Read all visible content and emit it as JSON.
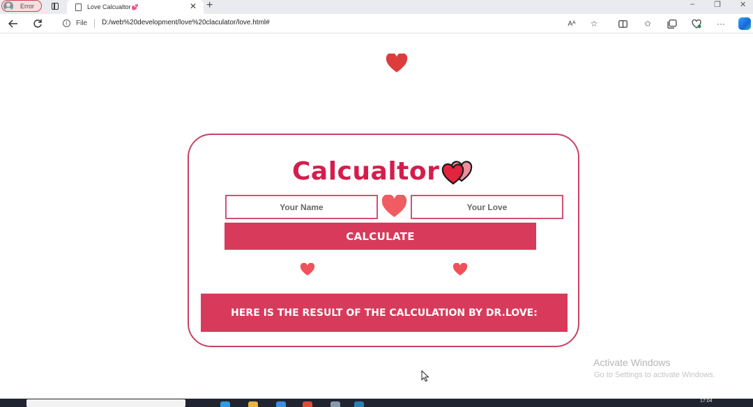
{
  "browser": {
    "profile_label": "Error",
    "tab_title": "Love Calcualtor",
    "tab_heart": "💕",
    "new_tab": "+",
    "tab_close": "✕",
    "file_label": "File",
    "url": "D:/web%20development/love%20claculator/love.html#",
    "window_controls": [
      "–",
      "❐",
      "✕"
    ],
    "icons": [
      "back-icon",
      "refresh-icon",
      "info-icon",
      "read-aloud-icon",
      "favorite-star-icon",
      "split-screen-icon",
      "favorites-icon",
      "collections-icon",
      "browser-essentials-icon",
      "more-icon",
      "copilot-icon"
    ]
  },
  "page": {
    "title": "Calcualtor",
    "name_placeholder": "Your Name",
    "love_placeholder": "Your Love",
    "calculate_label": "CALCULATE",
    "result_text": "HERE IS THE RESULT OF THE CALCULATION BY DR.LOVE:",
    "accent_color": "#d83a5b",
    "title_color": "#d51d4d"
  },
  "os": {
    "watermark_title": "Activate Windows",
    "watermark_sub": "Go to Settings to activate Windows.",
    "clock": "17:04"
  }
}
